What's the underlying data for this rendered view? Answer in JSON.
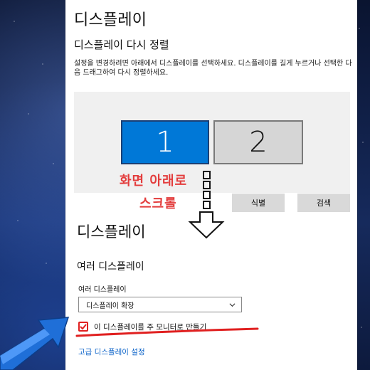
{
  "settings": {
    "title": "디스플레이",
    "rearrange_heading": "디스플레이 다시 정렬",
    "description": "설정을 변경하려면 아래에서 디스플레이를 선택하세요. 디스플레이를 길게 누르거나 선택한 다음 드래그하여 다시 정렬하세요.",
    "monitors": [
      {
        "label": "1",
        "selected": true
      },
      {
        "label": "2",
        "selected": false
      }
    ],
    "identify_button": "식별",
    "detect_button": "검색",
    "section_title": "디스플레이",
    "multi_heading": "여러 디스플레이",
    "multi_label": "여러 디스플레이",
    "multi_value": "디스플레이 확장",
    "main_monitor_checkbox": "이 디스플레이를 주 모니터로 만들기",
    "main_monitor_checked": true,
    "advanced_link": "고급 디스플레이 설정"
  },
  "annotation": {
    "line1": "화면 아래로",
    "line2": "스크롤",
    "color": "#e33c3c"
  },
  "colors": {
    "accent": "#0078d7",
    "link": "#0b62c8",
    "annotation": "#e33c3c",
    "arrow_blue": "#1f6fd8"
  }
}
